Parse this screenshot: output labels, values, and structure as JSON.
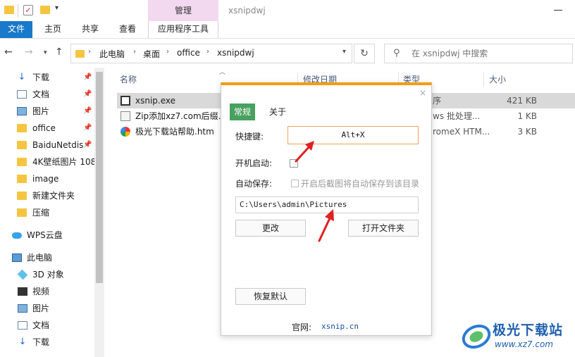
{
  "titlebar": {
    "manage_tab": "管理",
    "window_title": "xsnipdwj"
  },
  "ribbon": {
    "file": "文件",
    "home": "主页",
    "share": "共享",
    "view": "查看",
    "app_tools": "应用程序工具"
  },
  "address": {
    "crumbs": [
      "此电脑",
      "桌面",
      "office",
      "xsnipdwj"
    ],
    "search_placeholder": "在 xsnipdwj 中搜索"
  },
  "navpane": {
    "quick": [
      {
        "label": "下载",
        "icon": "download-icon",
        "pinned": true
      },
      {
        "label": "文档",
        "icon": "document-icon",
        "pinned": true
      },
      {
        "label": "图片",
        "icon": "picture-icon",
        "pinned": true
      },
      {
        "label": "office",
        "icon": "folder-icon",
        "pinned": true
      },
      {
        "label": "BaiduNetdis",
        "icon": "folder-icon",
        "pinned": true
      },
      {
        "label": "4K壁纸图片 108",
        "icon": "folder-icon",
        "pinned": false
      },
      {
        "label": "image",
        "icon": "folder-icon",
        "pinned": false
      },
      {
        "label": "新建文件夹",
        "icon": "folder-icon",
        "pinned": false
      },
      {
        "label": "压缩",
        "icon": "folder-icon",
        "pinned": false
      }
    ],
    "wps": "WPS云盘",
    "this_pc": "此电脑",
    "pc_items": [
      {
        "label": "3D 对象",
        "icon": "3d-objects-icon"
      },
      {
        "label": "视频",
        "icon": "video-icon"
      },
      {
        "label": "图片",
        "icon": "picture-icon"
      },
      {
        "label": "文档",
        "icon": "document-icon"
      },
      {
        "label": "下载",
        "icon": "download-icon"
      }
    ]
  },
  "filelist": {
    "columns": {
      "name": "名称",
      "date": "修改日期",
      "type": "类型",
      "size": "大小"
    },
    "rows": [
      {
        "name": "xsnip.exe",
        "type_part": "序",
        "size": "421 KB",
        "icon": "exe-icon"
      },
      {
        "name": "Zip添加xz7.com后缀.b",
        "type_part": "ws 批处理...",
        "size": "1 KB",
        "icon": "batch-icon"
      },
      {
        "name": "极光下载站帮助.htm",
        "type_part": "romeX HTM...",
        "size": "3 KB",
        "icon": "html-icon"
      }
    ]
  },
  "dialog": {
    "close": "×",
    "tab_general": "常规",
    "tab_about": "关于",
    "hotkey_label": "快捷键:",
    "hotkey_value": "Alt+X",
    "startup_label": "开机启动:",
    "autosave_label": "自动保存:",
    "autosave_option": "开启后截图将自动保存到该目录",
    "save_path": "C:\\Users\\admin\\Pictures",
    "change_button": "更改",
    "open_folder_button": "打开文件夹",
    "reset_button": "恢复默认",
    "website_label": "官网:",
    "website_link": "xsnip.cn"
  },
  "watermark": {
    "brand": "极光下载站",
    "url": "www.xz7.com"
  },
  "colors": {
    "file_tab": "#1979ca",
    "manage_tab": "#f2d9f0",
    "dialog_accent": "#f39c12",
    "general_tab": "#48a15f",
    "arrow": "#e02020"
  }
}
